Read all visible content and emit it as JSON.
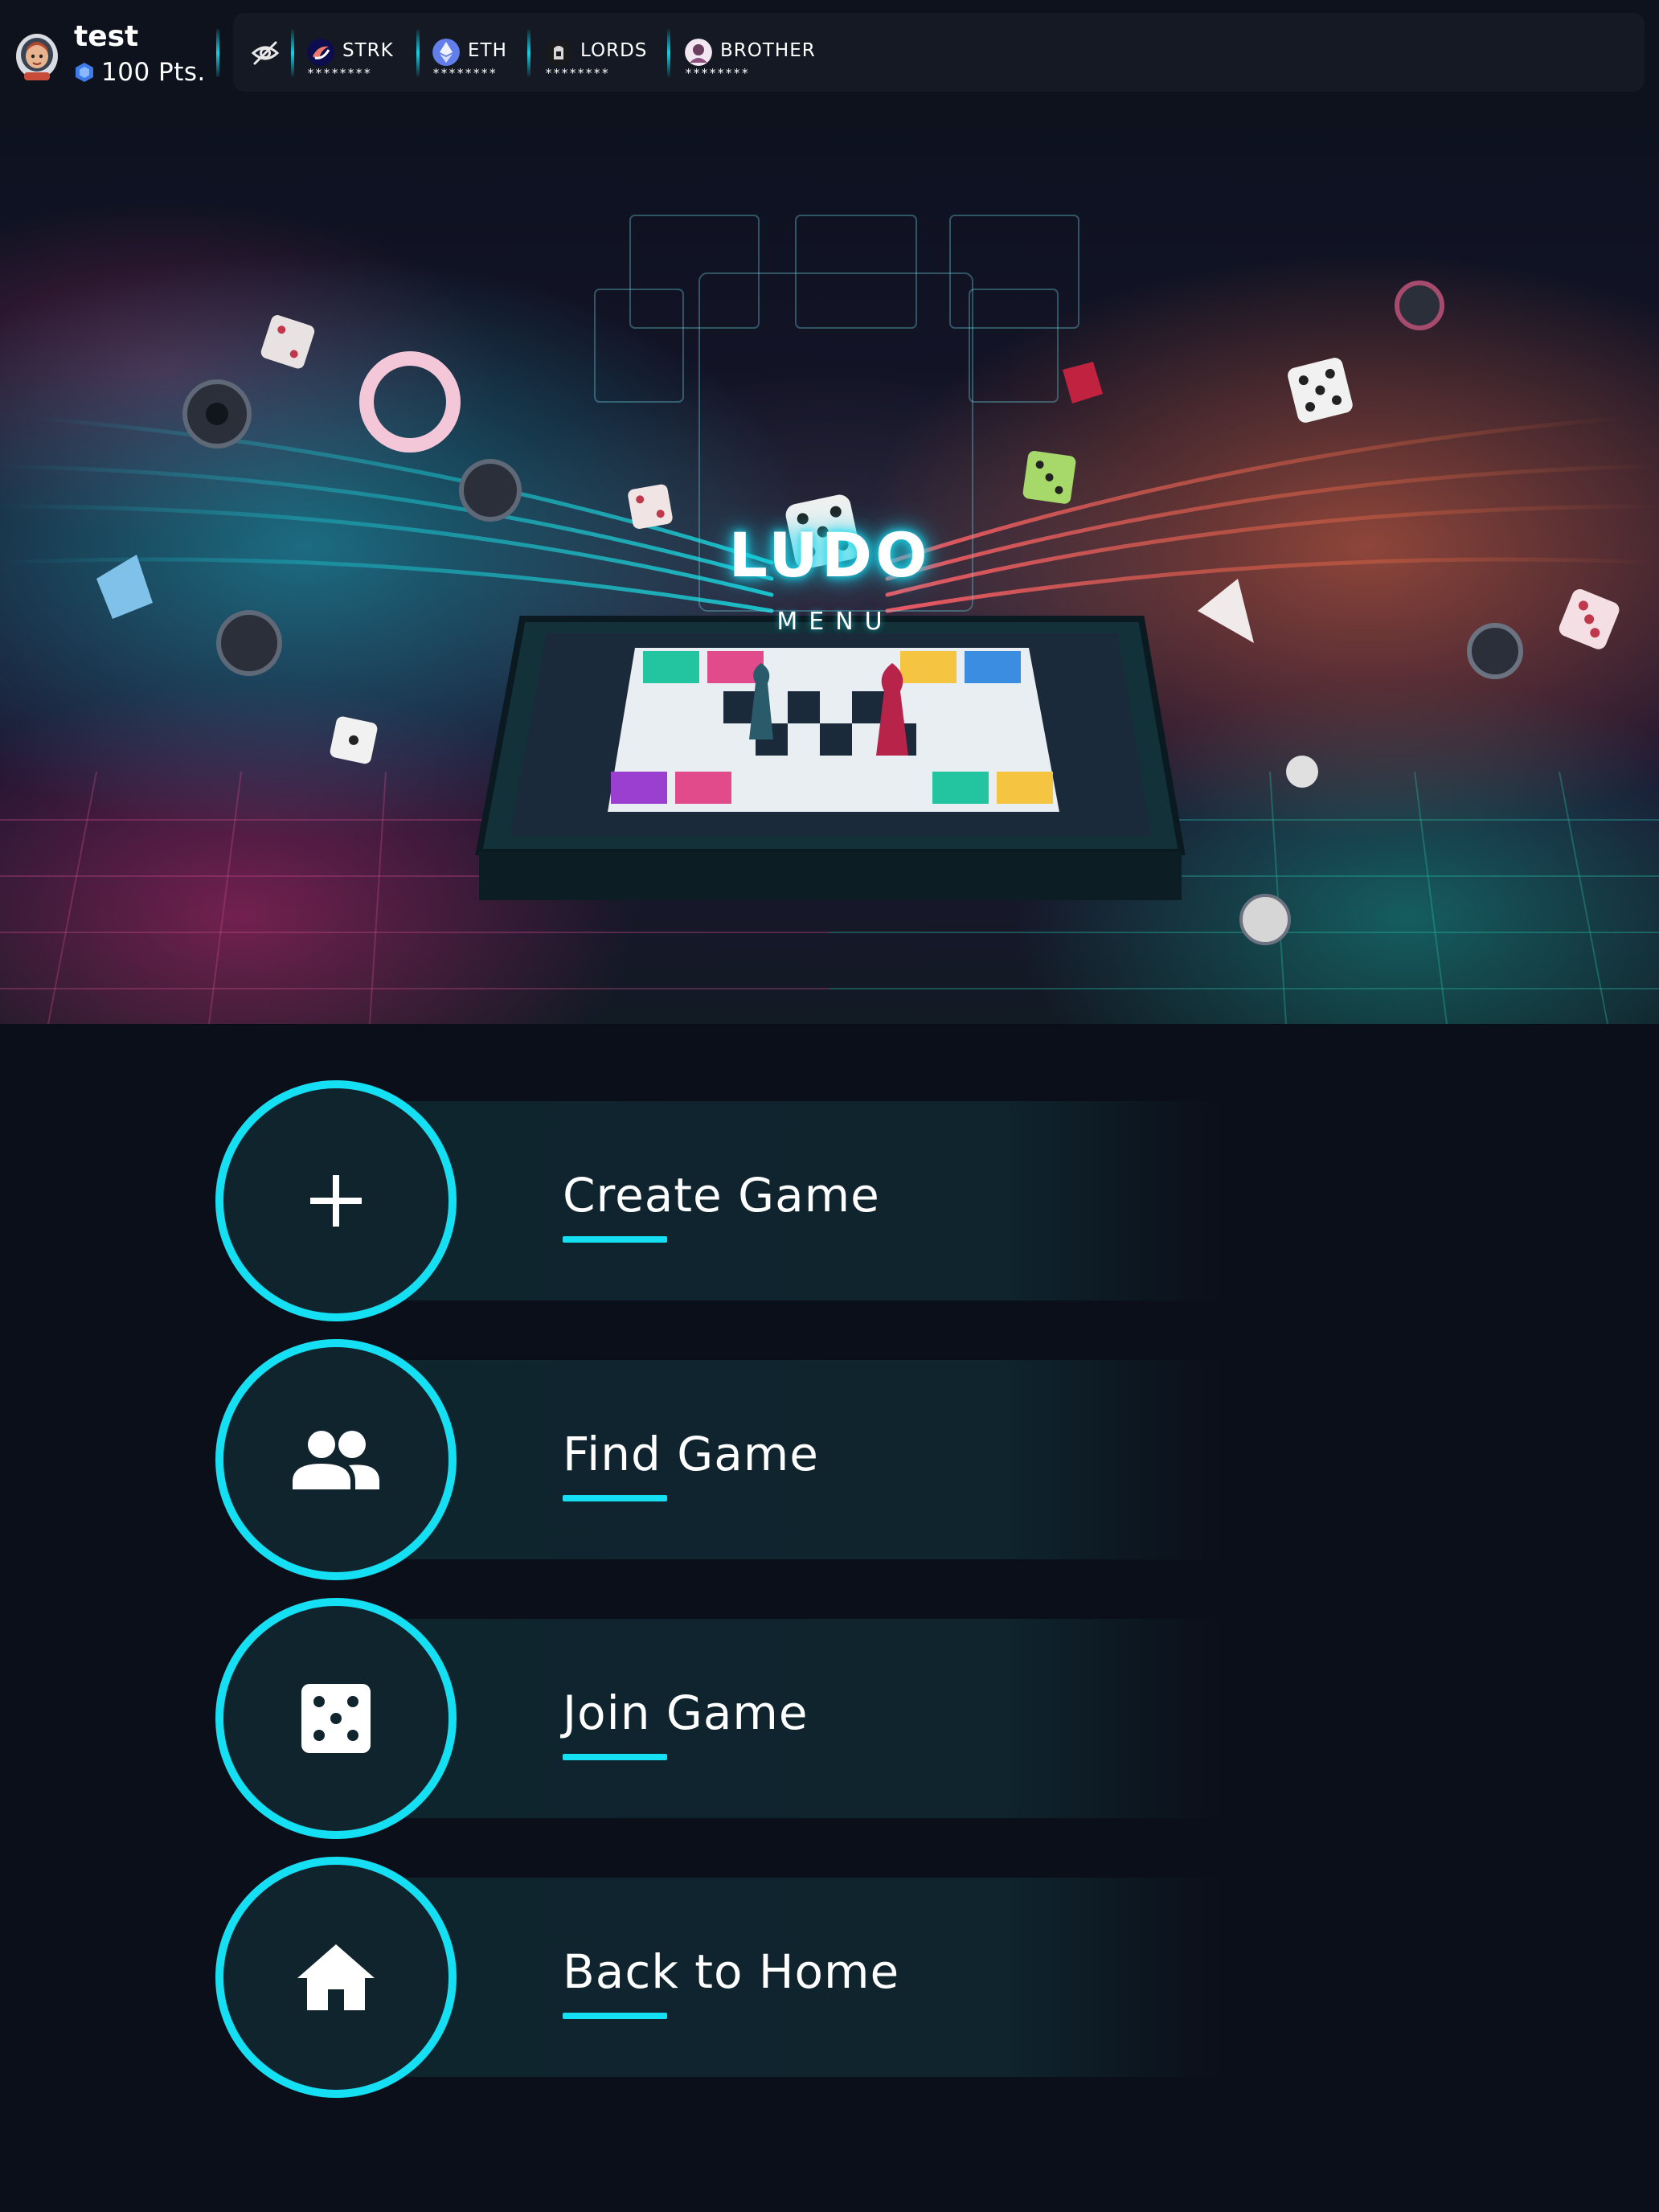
{
  "header": {
    "username": "test",
    "points": "100 Pts.",
    "visibility_toggle_icon": "eye-off-icon",
    "tokens": [
      {
        "symbol": "STRK",
        "balance": "********",
        "icon": "strk-token-icon",
        "color": "#6f6cf2"
      },
      {
        "symbol": "ETH",
        "balance": "********",
        "icon": "eth-token-icon",
        "color": "#627eea"
      },
      {
        "symbol": "LORDS",
        "balance": "********",
        "icon": "lords-token-icon",
        "color": "#2a2a2a"
      },
      {
        "symbol": "BROTHER",
        "balance": "********",
        "icon": "brother-token-icon",
        "color": "#e9d8ea"
      }
    ]
  },
  "hero": {
    "title": "LUDO",
    "subtitle": "MENU"
  },
  "menu": {
    "items": [
      {
        "label": "Create Game",
        "icon": "plus-icon"
      },
      {
        "label": "Find Game",
        "icon": "users-icon"
      },
      {
        "label": "Join Game",
        "icon": "dice-icon"
      },
      {
        "label": "Back to Home",
        "icon": "home-icon"
      }
    ]
  },
  "colors": {
    "accent": "#15dff2",
    "background": "#0b0f19",
    "panel": "#0f242d"
  }
}
